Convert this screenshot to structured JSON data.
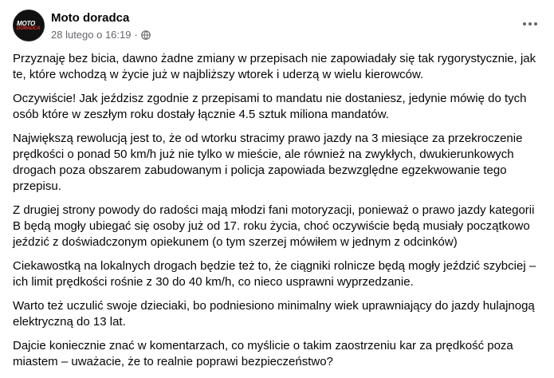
{
  "post": {
    "page_name": "Moto doradca",
    "timestamp": "28 lutego o 16:19",
    "separator": "·",
    "avatar": {
      "logo_top": "MOTO",
      "logo_bottom": "DORADCA"
    },
    "icons": {
      "privacy": "globe-icon",
      "menu": "more-horizontal-icon"
    },
    "paragraphs": [
      "Przyznaję bez bicia, dawno żadne zmiany w przepisach nie zapowiadały się tak rygorystycznie, jak te, które wchodzą w życie już w najbliższy wtorek i uderzą w wielu kierowców.",
      "Oczywiście! Jak jeździsz zgodnie z przepisami to mandatu nie dostaniesz, jedynie mówię do tych osób które w zeszłym roku dostały łącznie 4.5 sztuk miliona mandatów.",
      "Największą rewolucją jest to, że od wtorku stracimy prawo jazdy na 3 miesiące za przekroczenie prędkości o ponad 50 km/h już nie tylko w mieście, ale również na zwykłych, dwukierunkowych drogach poza obszarem zabudowanym i policja zapowiada bezwzględne egzekwowanie tego przepisu.",
      "Z drugiej strony powody do radości mają młodzi fani motoryzacji, ponieważ o prawo jazdy kategorii B będą mogły ubiegać się osoby już od 17. roku życia, choć oczywiście będą musiały początkowo jeździć z doświadczonym opiekunem (o tym szerzej mówiłem w jednym z odcinków)",
      "Ciekawostką na lokalnych drogach będzie też to, że ciągniki rolnicze będą mogły jeździć szybciej – ich limit prędkości rośnie z 30 do 40 km/h, co nieco usprawni wyprzedzanie.",
      "Warto też uczulić swoje dzieciaki, bo podniesiono minimalny wiek uprawniający do jazdy hulajnogą elektryczną do 13 lat.",
      "Dajcie koniecznie znać w komentarzach, co myślicie o takim zaostrzeniu kar za prędkość poza miastem – uważacie, że to realnie poprawi bezpieczeństwo?"
    ]
  },
  "colors": {
    "text": "#050505",
    "secondary": "#65676b",
    "brand_red": "#e0312b"
  }
}
